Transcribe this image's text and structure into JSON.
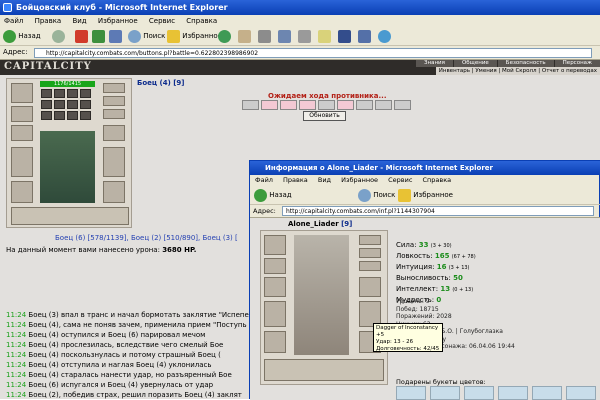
{
  "window": {
    "title": "Бойцовский клуб - Microsoft Internet Explorer"
  },
  "menu": [
    "Файл",
    "Правка",
    "Вид",
    "Избранное",
    "Сервис",
    "Справка"
  ],
  "toolbar": {
    "back": "Назад",
    "search": "Поиск",
    "favorites": "Избранное"
  },
  "address": {
    "label": "Адрес:",
    "url": "http://capitalcity.combats.com/buttons.pl?battle=0.622802398986902"
  },
  "site": {
    "logo": "CAPITALCITY",
    "nav_tabs": [
      "Знания",
      "Общение",
      "Безопасность",
      "Персонаж"
    ],
    "sub_nav": "Инвентарь | Умения | Мой Скролл | Отчет о переводах"
  },
  "battle": {
    "hp": "1176/1415",
    "left_name": "Боец (4)",
    "left_level": "[9]",
    "waiting": "Ожидаем хода противника...",
    "refresh": "Обновить",
    "fighters_line": "Боец (6) [578/1139], Боец (2) [510/890], Боец (3) [",
    "damage_label": "На данный момент вами нанесено урона:",
    "damage_value": "3680 HP."
  },
  "log": [
    {
      "time": "11:24",
      "text": "Боец (3) впал в транс и начал бормотать заклятие \"Испепе"
    },
    {
      "time": "11:24",
      "text": "Боец (4), сама не поняв зачем, применила прием \"Поступь"
    },
    {
      "time": "11:24",
      "text": "Боец (4) оступился и Боец (6) парировал мечом"
    },
    {
      "time": "11:24",
      "text": "Боец (4) прослезилась, вследствие чего смелый Бое"
    },
    {
      "time": "11:24",
      "text": "Боец (4) поскользнулась и потому страшный Боец ("
    },
    {
      "time": "11:24",
      "text": "Боец (4) отступила и наглая Боец (4) уклонилась"
    },
    {
      "time": "11:24",
      "text": "Боец (4) старалась нанести удар, но разъяренный Бое"
    },
    {
      "time": "11:24",
      "text": "Боец (6) испугался и Боец (4) увернулась от удар"
    },
    {
      "time": "11:24",
      "text": "Боец (2), победив страх, решил поразить Боец (4) заклят"
    },
    {
      "time": "11:24",
      "text": "Боец (2) чесал <вырезано цензурой>, а за это Боец (3)"
    }
  ],
  "popup": {
    "title": "Информация о Alone_Liader - Microsoft Internet Explorer",
    "menu": [
      "Файл",
      "Правка",
      "Вид",
      "Избранное",
      "Сервис",
      "Справка"
    ],
    "back": "Назад",
    "search": "Поиск",
    "favorites": "Избранное",
    "address_label": "Адрес:",
    "url": "http://capitalcity.combats.com/inf.pl?1144307904",
    "name": "Alone_Liader",
    "level": "[9]",
    "stats": [
      {
        "label": "Сила:",
        "value": "33",
        "extra": "(3 + 30)"
      },
      {
        "label": "Ловкость:",
        "value": "165",
        "extra": "(67 + 78)"
      },
      {
        "label": "Интуиция:",
        "value": "16",
        "extra": "(3 + 13)"
      },
      {
        "label": "Выносливость:",
        "value": "50",
        "extra": ""
      },
      {
        "label": "Интеллект:",
        "value": "13",
        "extra": "(0 + 13)"
      },
      {
        "label": "Мудрость:",
        "value": "0",
        "extra": ""
      }
    ],
    "info": [
      "Уровень: 9",
      "Побед: 18715",
      "Поражений: 2028",
      "Ничьих: 63",
      "Склонность: - Б.О. | Голубоглазка",
      "Город: Mooncity",
      "Рождение персонажа: 06.04.06 19:44"
    ],
    "tooltip": [
      "Dagger of Inconstancy +5",
      "Удар: 13 - 26",
      "Долговечность: 42/45"
    ],
    "flowers_label": "Подарены букеты цветов:"
  }
}
